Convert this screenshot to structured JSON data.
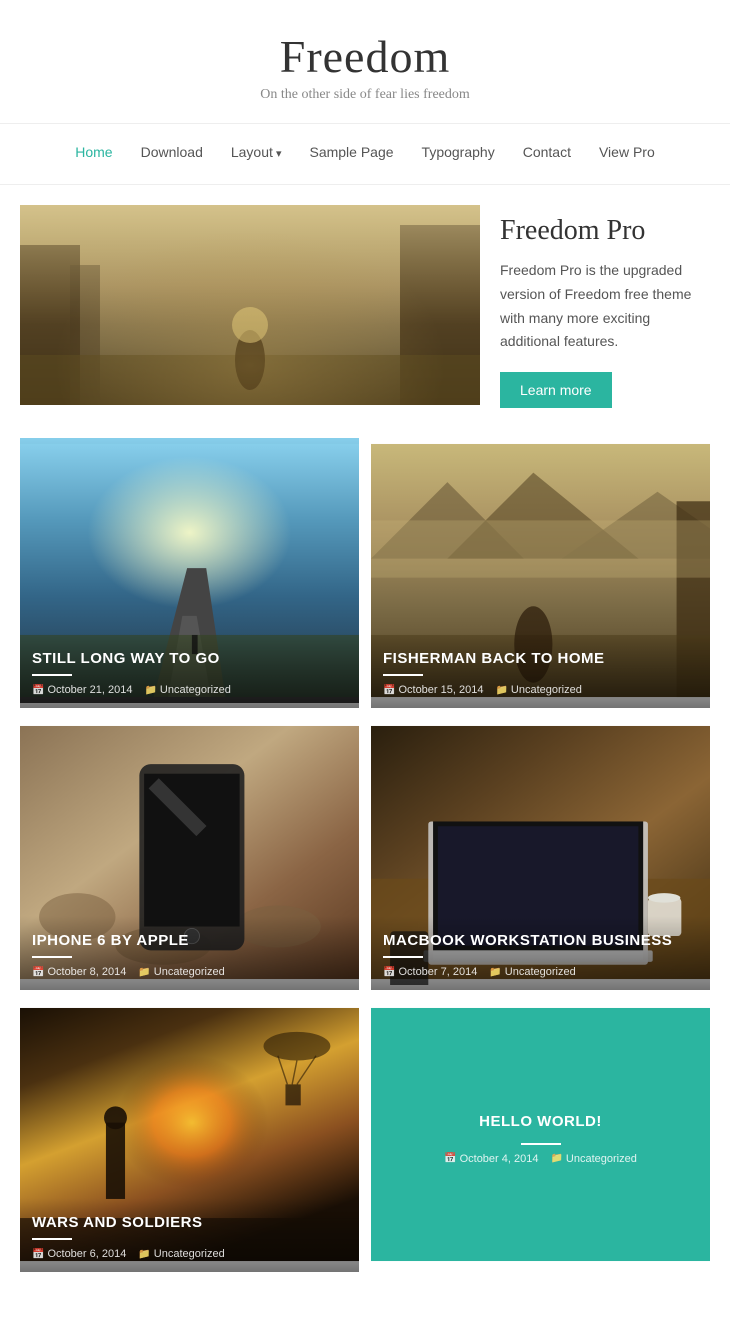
{
  "site": {
    "title": "Freedom",
    "tagline": "On the other side of fear lies freedom"
  },
  "nav": {
    "items": [
      {
        "label": "Home",
        "active": true,
        "has_dropdown": false
      },
      {
        "label": "Download",
        "active": false,
        "has_dropdown": false
      },
      {
        "label": "Layout",
        "active": false,
        "has_dropdown": true
      },
      {
        "label": "Sample Page",
        "active": false,
        "has_dropdown": false
      },
      {
        "label": "Typography",
        "active": false,
        "has_dropdown": false
      },
      {
        "label": "Contact",
        "active": false,
        "has_dropdown": false
      },
      {
        "label": "View Pro",
        "active": false,
        "has_dropdown": false
      }
    ]
  },
  "hero": {
    "title": "Freedom Pro",
    "description": "Freedom Pro is the upgraded version of Freedom free theme with many more exciting additional features.",
    "cta_label": "Learn more"
  },
  "posts": [
    {
      "title": "STILL LONG WAY TO GO",
      "date": "October 21, 2014",
      "category": "Uncategorized",
      "img_class": "img-road"
    },
    {
      "title": "FISHERMAN BACK TO HOME",
      "date": "October 15, 2014",
      "category": "Uncategorized",
      "img_class": "img-fisherman"
    },
    {
      "title": "IPHONE 6 BY APPLE",
      "date": "October 8, 2014",
      "category": "Uncategorized",
      "img_class": "img-iphone"
    },
    {
      "title": "MACBOOK WORKSTATION BUSINESS",
      "date": "October 7, 2014",
      "category": "Uncategorized",
      "img_class": "img-macbook"
    },
    {
      "title": "WARS AND SOLDIERS",
      "date": "October 6, 2014",
      "category": "Uncategorized",
      "img_class": "img-soldiers"
    },
    {
      "title": "HELLO WORLD!",
      "date": "October 4, 2014",
      "category": "Uncategorized",
      "img_class": "img-teal",
      "centered": true
    }
  ],
  "icons": {
    "calendar": "📅",
    "folder": "📁",
    "dropdown_arrow": "▾"
  }
}
